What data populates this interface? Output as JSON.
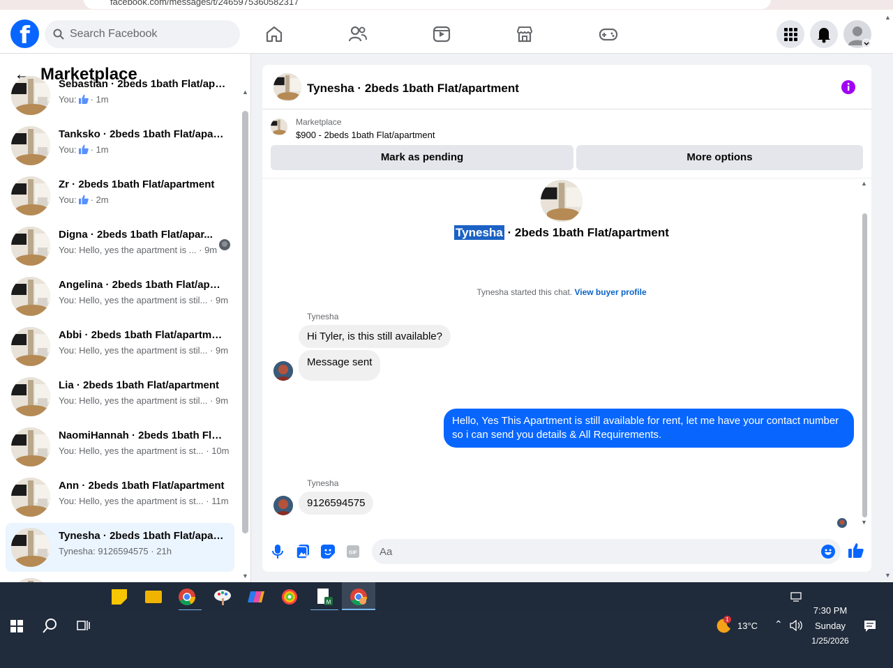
{
  "browser": {
    "url": "facebook.com/messages/t/2465975360582317"
  },
  "nav": {
    "search_placeholder": "Search Facebook"
  },
  "sidebar": {
    "title": "Marketplace",
    "items": [
      {
        "name": "Sebastian · 2beds 1bath Flat/apa...",
        "sub": "You:",
        "time": "· 1m",
        "like": true
      },
      {
        "name": "Tanksko · 2beds 1bath Flat/apart...",
        "sub": "You:",
        "time": "· 1m",
        "like": true
      },
      {
        "name": "Zr · 2beds 1bath Flat/apartment",
        "sub": "You:",
        "time": "· 2m",
        "like": true
      },
      {
        "name": "Digna · 2beds 1bath Flat/apar...",
        "sub": "You: Hello, yes the apartment is ...",
        "time": "· 9m"
      },
      {
        "name": "Angelina · 2beds 1bath Flat/apar...",
        "sub": "You: Hello, yes the apartment is stil...",
        "time": "· 9m"
      },
      {
        "name": "Abbi · 2beds 1bath Flat/apartment",
        "sub": "You: Hello, yes the apartment is stil...",
        "time": "· 9m"
      },
      {
        "name": "Lia · 2beds 1bath Flat/apartment",
        "sub": "You: Hello, yes the apartment is stil...",
        "time": "· 9m"
      },
      {
        "name": "NaomiHannah · 2beds 1bath Fla...",
        "sub": "You: Hello, yes the apartment is st...",
        "time": "· 10m"
      },
      {
        "name": "Ann · 2beds 1bath Flat/apartment",
        "sub": "You: Hello, yes the apartment is st...",
        "time": "· 11m"
      },
      {
        "name": "Tynesha · 2beds 1bath Flat/apart...",
        "sub": "Tynesha: 9126594575",
        "time": "· 21h"
      }
    ]
  },
  "chat": {
    "title": "Tynesha · 2beds 1bath Flat/apartment",
    "listing_label": "Marketplace",
    "listing_price": "$900 - 2beds 1bath Flat/apartment",
    "mark_pending": "Mark as pending",
    "more_options": "More options",
    "intro_name": "Tynesha",
    "intro_rest": " · 2beds 1bath Flat/apartment",
    "started_text": "Tynesha started this chat.",
    "view_profile": "View buyer profile",
    "sender1": "Tynesha",
    "msg1": "Hi Tyler, is this still available?",
    "msg2": "Message sent",
    "reply_line1": "Hello, Yes This Apartment is still available for rent, let me have your contact number",
    "reply_line2": "so i can send you details & All Requirements.",
    "sender2": "Tynesha",
    "msg3": "9126594575",
    "composer_placeholder": "Aa"
  },
  "taskbar": {
    "weather": "13°C",
    "weather_badge": "1",
    "time": "7:30 PM",
    "day": "Sunday",
    "date": "1/25/2026"
  }
}
